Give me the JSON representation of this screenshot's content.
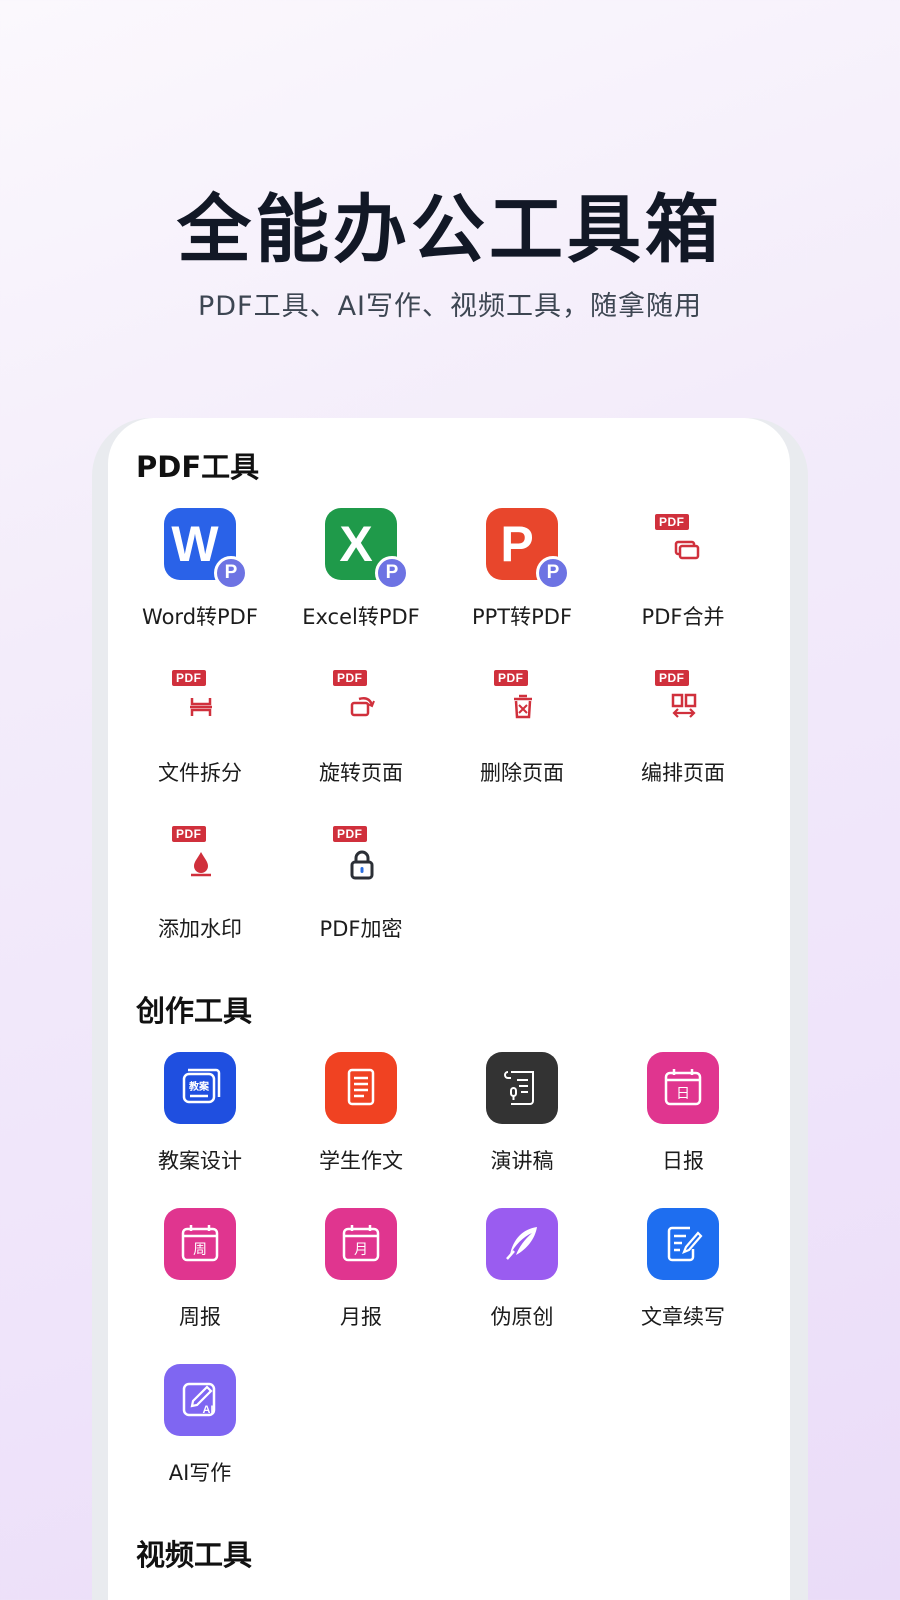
{
  "hero": {
    "title": "全能办公工具箱",
    "subtitle": "PDF工具、AI写作、视频工具，随拿随用"
  },
  "colors": {
    "word": "#2a62e8",
    "excel": "#1f9a4a",
    "ppt": "#e8462c",
    "pdf_red": "#d0303c",
    "badge": "#6d73e3",
    "blue_app": "#1f4fe0",
    "orange_app": "#f04222",
    "dark_app": "#333333",
    "pink_app": "#e0358f",
    "purple_app": "#9a5cf0",
    "bright_blue_app": "#1e6ef0",
    "violet_app": "#7f66f2"
  },
  "sections": {
    "pdf": {
      "title": "PDF工具",
      "tools": [
        {
          "label": "Word转PDF",
          "icon": "word-to-pdf-icon"
        },
        {
          "label": "Excel转PDF",
          "icon": "excel-to-pdf-icon"
        },
        {
          "label": "PPT转PDF",
          "icon": "ppt-to-pdf-icon"
        },
        {
          "label": "PDF合并",
          "icon": "pdf-merge-icon"
        },
        {
          "label": "文件拆分",
          "icon": "pdf-split-icon"
        },
        {
          "label": "旋转页面",
          "icon": "pdf-rotate-icon"
        },
        {
          "label": "删除页面",
          "icon": "pdf-delete-icon"
        },
        {
          "label": "编排页面",
          "icon": "pdf-arrange-icon"
        },
        {
          "label": "添加水印",
          "icon": "pdf-watermark-icon"
        },
        {
          "label": "PDF加密",
          "icon": "pdf-lock-icon"
        }
      ],
      "pdf_tag": "PDF"
    },
    "creation": {
      "title": "创作工具",
      "tools": [
        {
          "label": "教案设计",
          "icon": "lesson-plan-icon",
          "glyph": "教案"
        },
        {
          "label": "学生作文",
          "icon": "student-essay-icon"
        },
        {
          "label": "演讲稿",
          "icon": "speech-icon"
        },
        {
          "label": "日报",
          "icon": "daily-report-icon",
          "glyph": "日"
        },
        {
          "label": "周报",
          "icon": "weekly-report-icon",
          "glyph": "周"
        },
        {
          "label": "月报",
          "icon": "monthly-report-icon",
          "glyph": "月"
        },
        {
          "label": "伪原创",
          "icon": "rewrite-icon"
        },
        {
          "label": "文章续写",
          "icon": "article-continue-icon"
        },
        {
          "label": "AI写作",
          "icon": "ai-writing-icon",
          "glyph": "AI"
        }
      ]
    },
    "video": {
      "title": "视频工具"
    }
  },
  "brand_letters": {
    "word": "W",
    "excel": "X",
    "ppt": "P",
    "badge": "P"
  }
}
